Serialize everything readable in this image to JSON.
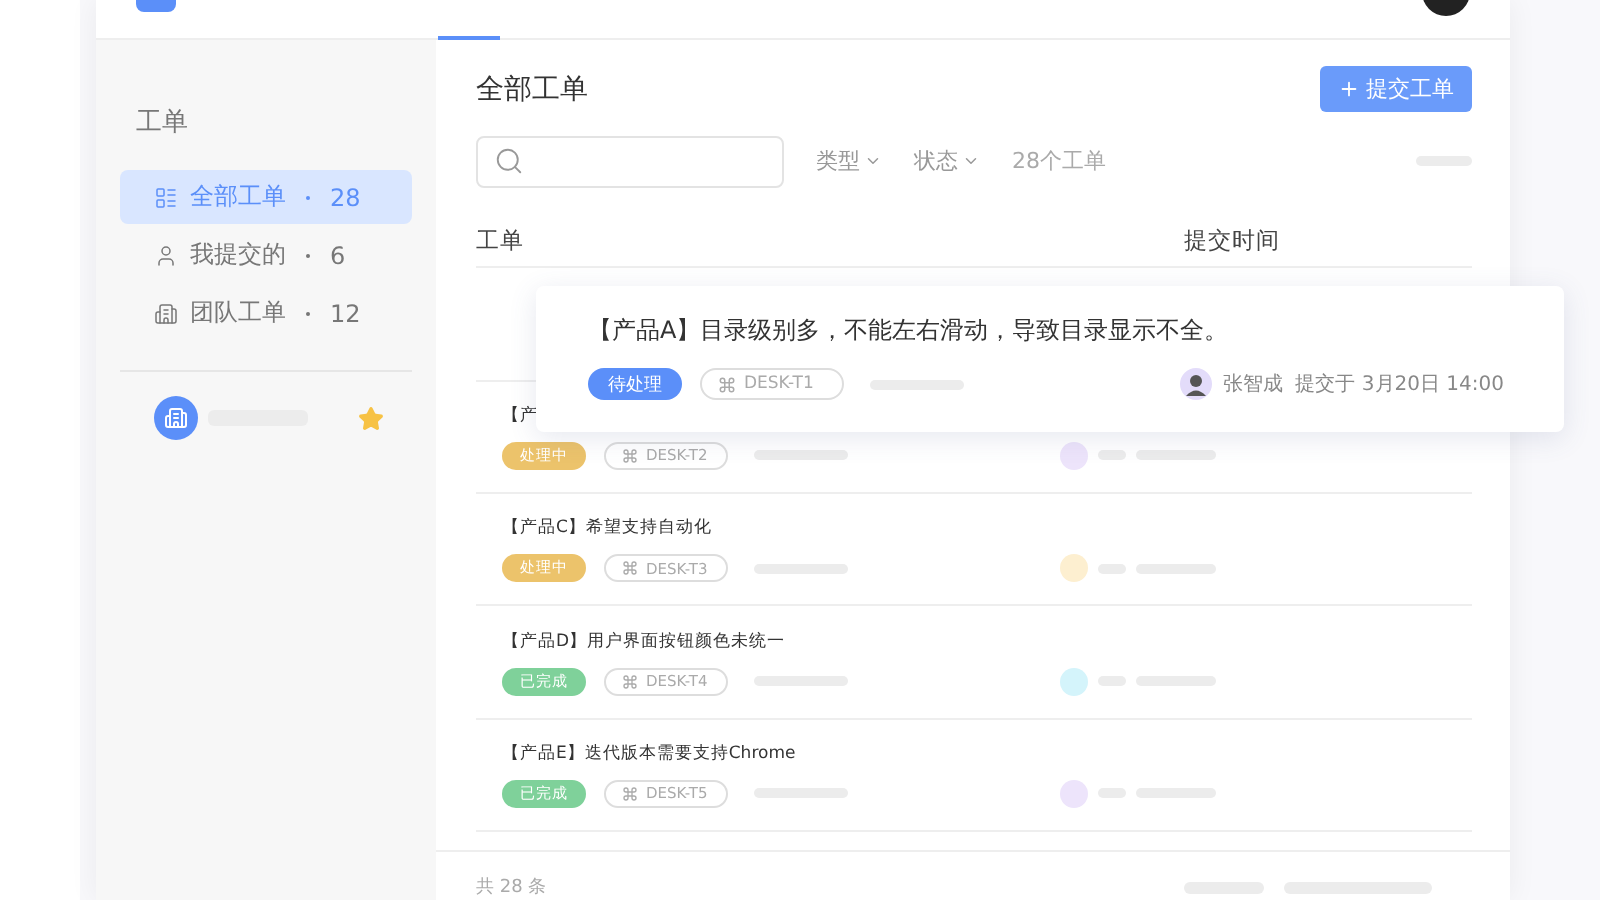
{
  "sidebar": {
    "title": "工单",
    "items": [
      {
        "label": "全部工单",
        "count": "28",
        "selected": true
      },
      {
        "label": "我提交的",
        "count": "6",
        "selected": false
      },
      {
        "label": "团队工单",
        "count": "12",
        "selected": false
      }
    ],
    "favorite": {
      "starred": true
    }
  },
  "main": {
    "title": "全部工单",
    "submit_button": "提交工单",
    "filters": [
      "类型",
      "状态"
    ],
    "total": "28个工单",
    "columns": [
      "工单",
      "提交时间"
    ],
    "rows": [
      {
        "title": "【产",
        "status": "处理中",
        "kind": "processing",
        "tag": "DESK-T2",
        "color": "#ede4fb"
      },
      {
        "title": "【产品C】希望支持自动化",
        "status": "处理中",
        "kind": "processing",
        "tag": "DESK-T3",
        "color": "#fdefd0"
      },
      {
        "title": "【产品D】用户界面按钮颜色未统一",
        "status": "已完成",
        "kind": "done",
        "tag": "DESK-T4",
        "color": "#d4f4fb"
      },
      {
        "title": "【产品E】迭代版本需要支持Chrome",
        "status": "已完成",
        "kind": "done",
        "tag": "DESK-T5",
        "color": "#ede4fb"
      }
    ],
    "footer": "共 28 条"
  },
  "popup_card": {
    "title": "【产品A】目录级别多，不能左右滑动，导致目录显示不全。",
    "status": "待处理",
    "kind": "pending",
    "tag": "DESK-T1",
    "author": "张智成",
    "submitted": "提交于 3月20日 14:00"
  }
}
